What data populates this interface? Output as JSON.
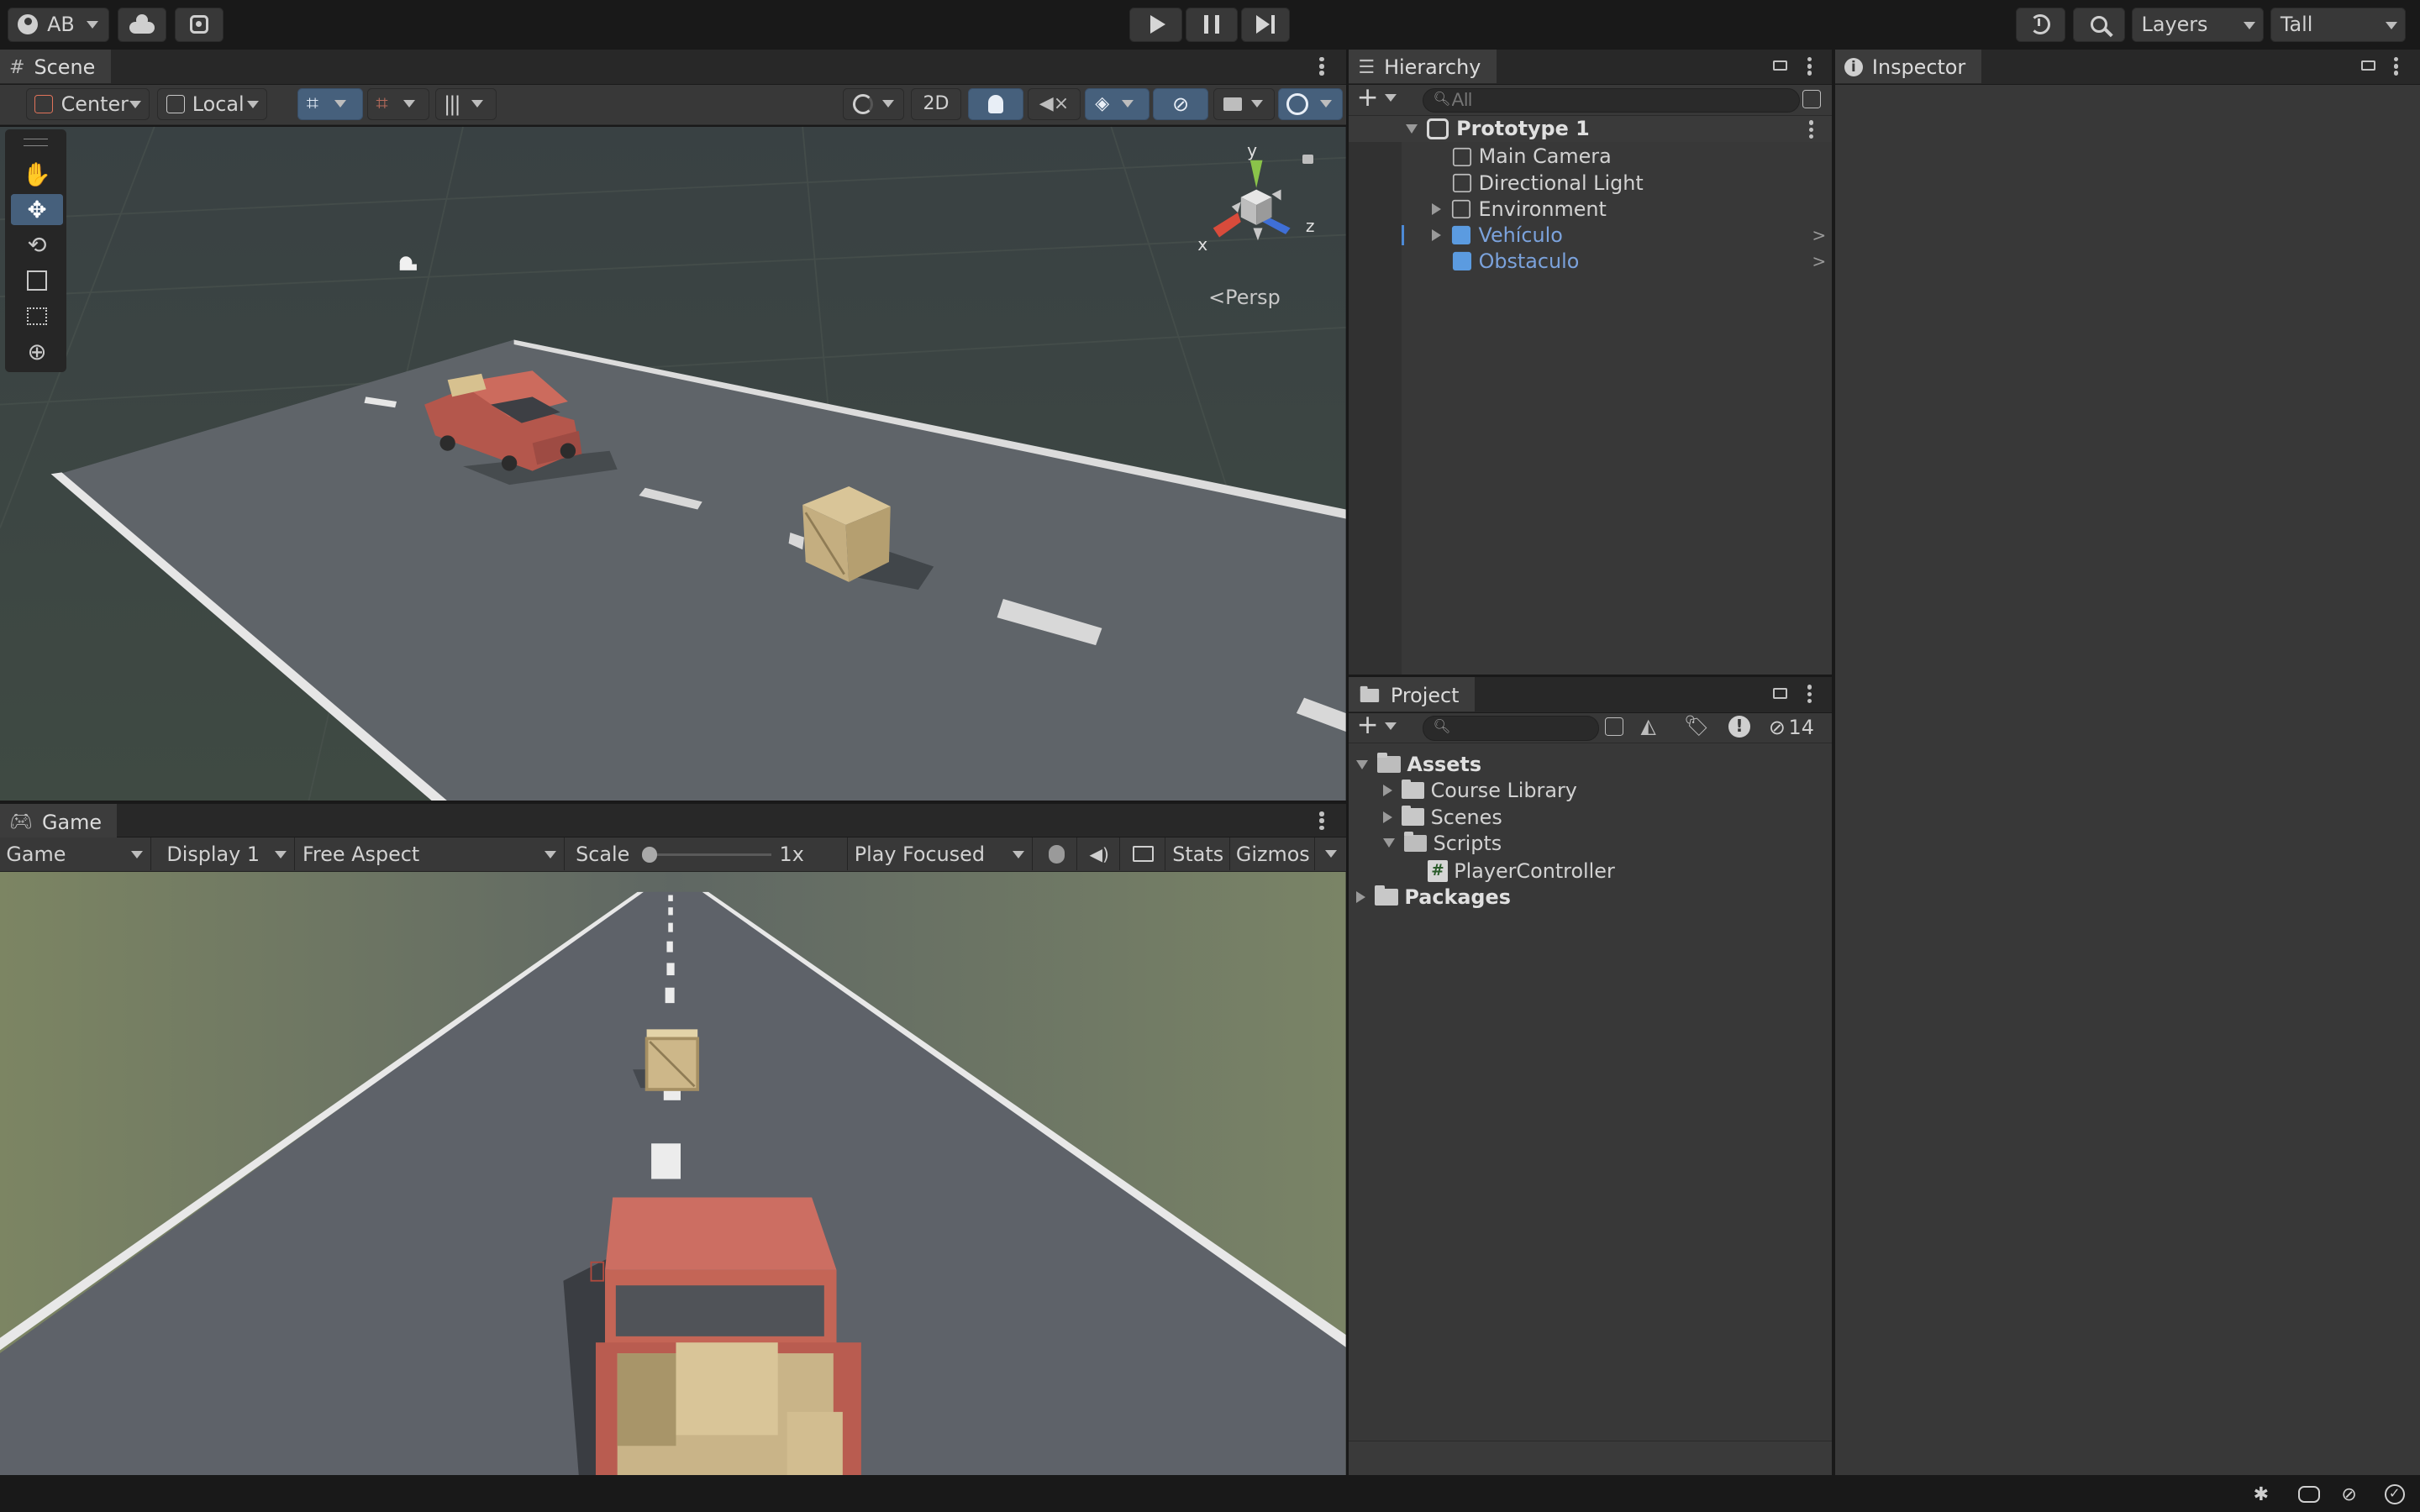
{
  "toolbar": {
    "account_initials": "AB",
    "play_label": "Play",
    "layers_label": "Layers",
    "layout_label": "Tall"
  },
  "scene": {
    "tab_label": "Scene",
    "pivot_label": "Center",
    "space_label": "Local",
    "two_d_label": "2D",
    "persp_label": "Persp",
    "gizmo_axes": {
      "x": "x",
      "y": "y",
      "z": "z"
    }
  },
  "game": {
    "tab_label": "Game",
    "view_select": "Game",
    "display_select": "Display 1",
    "aspect_select": "Free Aspect",
    "scale_label": "Scale",
    "scale_value": "1x",
    "scale_fraction": 0.0,
    "play_mode_select": "Play Focused",
    "stats_label": "Stats",
    "gizmos_label": "Gizmos"
  },
  "hierarchy": {
    "tab_label": "Hierarchy",
    "search_placeholder": "All",
    "scene_name": "Prototype 1",
    "items": [
      {
        "label": "Main Camera",
        "prefab": false,
        "expandable": false
      },
      {
        "label": "Directional Light",
        "prefab": false,
        "expandable": false
      },
      {
        "label": "Environment",
        "prefab": false,
        "expandable": true
      },
      {
        "label": "Vehículo",
        "prefab": true,
        "expandable": true
      },
      {
        "label": "Obstaculo",
        "prefab": true,
        "expandable": false
      }
    ]
  },
  "project": {
    "tab_label": "Project",
    "hidden_count": "14",
    "tree": {
      "assets": "Assets",
      "course_library": "Course Library",
      "scenes": "Scenes",
      "scripts": "Scripts",
      "player_controller": "PlayerController",
      "packages": "Packages"
    }
  },
  "inspector": {
    "tab_label": "Inspector"
  },
  "colors": {
    "accent": "#46607c",
    "prefab_blue": "#7ba2dc",
    "panel": "#383838",
    "toolbar": "#191919"
  }
}
